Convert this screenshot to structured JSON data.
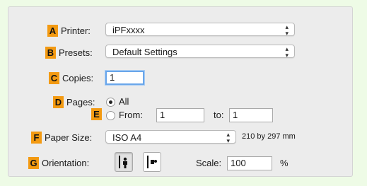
{
  "printer": {
    "badge": "A",
    "label": "Printer:",
    "value": "iPFxxxx"
  },
  "presets": {
    "badge": "B",
    "label": "Presets:",
    "value": "Default Settings"
  },
  "copies": {
    "badge": "C",
    "label": "Copies:",
    "value": "1"
  },
  "pages": {
    "badge": "D",
    "label": "Pages:",
    "all_label": "All",
    "from_badge": "E",
    "from_label": "From:",
    "from_value": "1",
    "to_label": "to:",
    "to_value": "1",
    "selected": "All"
  },
  "paper_size": {
    "badge": "F",
    "label": "Paper Size:",
    "value": "ISO A4",
    "dimensions": "210 by 297 mm"
  },
  "orientation": {
    "badge": "G",
    "label": "Orientation:",
    "selected": "portrait"
  },
  "scale": {
    "label": "Scale:",
    "value": "100",
    "unit": "%"
  },
  "icons": {
    "popup_arrows": "updown-arrows-icon",
    "portrait": "portrait-orientation-icon",
    "landscape": "landscape-orientation-icon"
  }
}
